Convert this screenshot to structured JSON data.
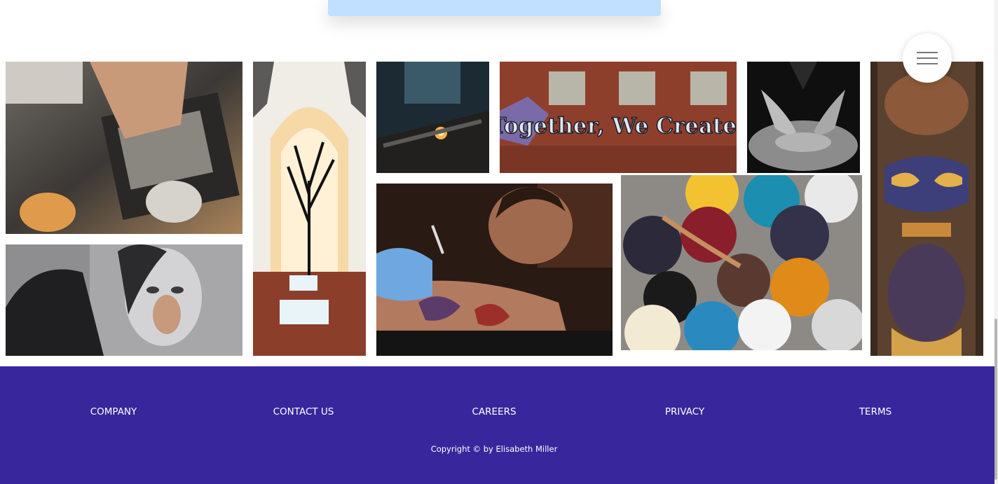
{
  "menu": {
    "icon": "hamburger-icon"
  },
  "gallery": {
    "images": [
      {
        "name": "spray-paint-stencil-art"
      },
      {
        "name": "tree-sculpture-gallery"
      },
      {
        "name": "welding-torch"
      },
      {
        "name": "brick-wall-graffiti",
        "text": "Together, We Create!"
      },
      {
        "name": "pottery-hands"
      },
      {
        "name": "carved-totem"
      },
      {
        "name": "pencil-portrait-drawing"
      },
      {
        "name": "tattoo-artist"
      },
      {
        "name": "paint-buckets"
      }
    ]
  },
  "footer": {
    "links": [
      "COMPANY",
      "CONTACT US",
      "CAREERS",
      "PRIVACY",
      "TERMS"
    ],
    "copyright": "Copyright © by Elisabeth Miller"
  },
  "colors": {
    "footer_bg": "#38269c",
    "top_card": "#bfe0ff"
  }
}
